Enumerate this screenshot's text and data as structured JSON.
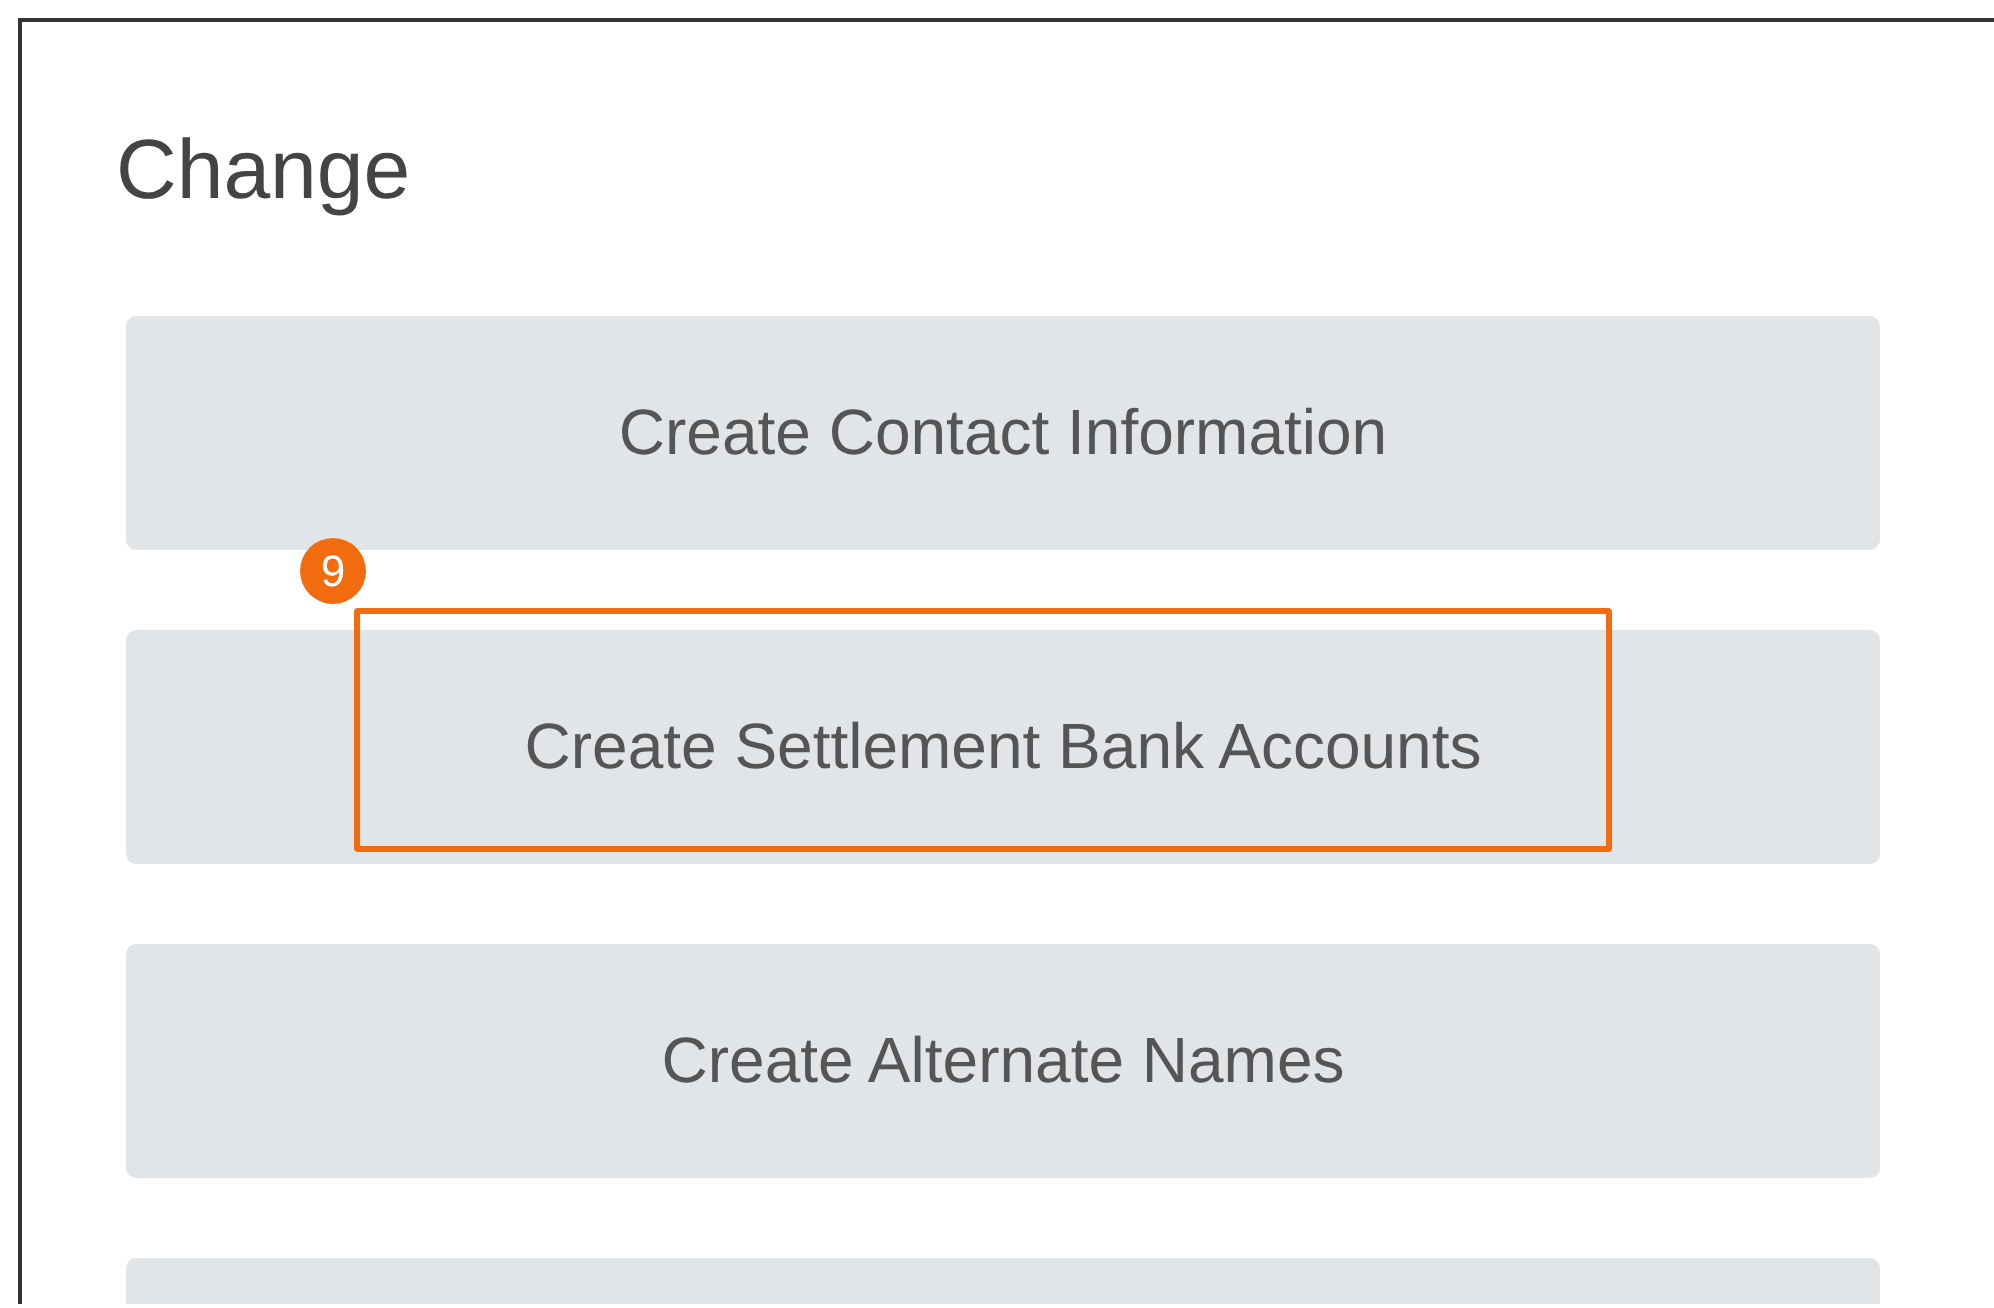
{
  "title": "Change",
  "buttons": [
    {
      "kind": "button",
      "label": "Create Contact Information"
    },
    {
      "kind": "button",
      "label": "Create Settlement Bank Accounts",
      "callout": "9"
    },
    {
      "kind": "button",
      "label": "Create Alternate Names"
    },
    {
      "kind": "button"
    }
  ]
}
